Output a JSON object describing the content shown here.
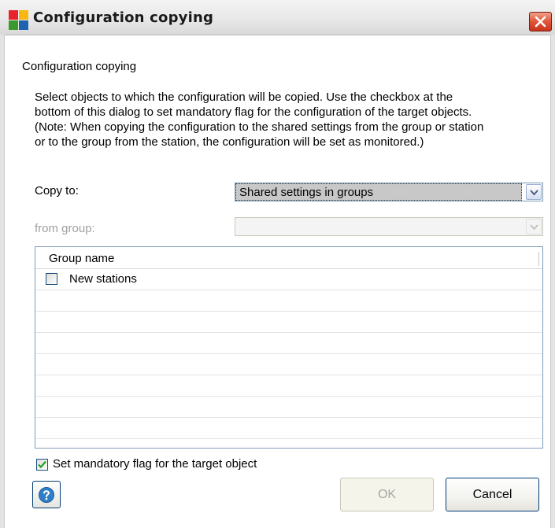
{
  "window": {
    "title": "Configuration copying",
    "app_icon": "avg-logo-icon",
    "close_icon": "close-icon"
  },
  "dialog": {
    "heading": "Configuration copying",
    "description": "Select objects to which the configuration will be copied. Use the checkbox at the\nbottom of this dialog to set mandatory flag for the configuration of the target objects.\n(Note: When copying the configuration to the shared settings from the group or station\nor to the group from the station, the configuration will be set as monitored.)",
    "copy_to": {
      "label": "Copy to:",
      "selected": "Shared settings in groups"
    },
    "from_group": {
      "label": "from group:",
      "selected": "",
      "enabled": false
    },
    "list": {
      "column_header": "Group name",
      "rows": [
        {
          "label": "New stations",
          "checked": false
        }
      ],
      "empty_rows": 7
    },
    "mandatory": {
      "label": "Set mandatory flag for the target object",
      "checked": true
    },
    "buttons": {
      "help_icon": "help-icon",
      "ok": "OK",
      "ok_enabled": false,
      "cancel": "Cancel"
    }
  },
  "colors": {
    "close_button": "#e0553a",
    "help_icon": "#2f7fc8",
    "check_mark": "#21a121"
  }
}
